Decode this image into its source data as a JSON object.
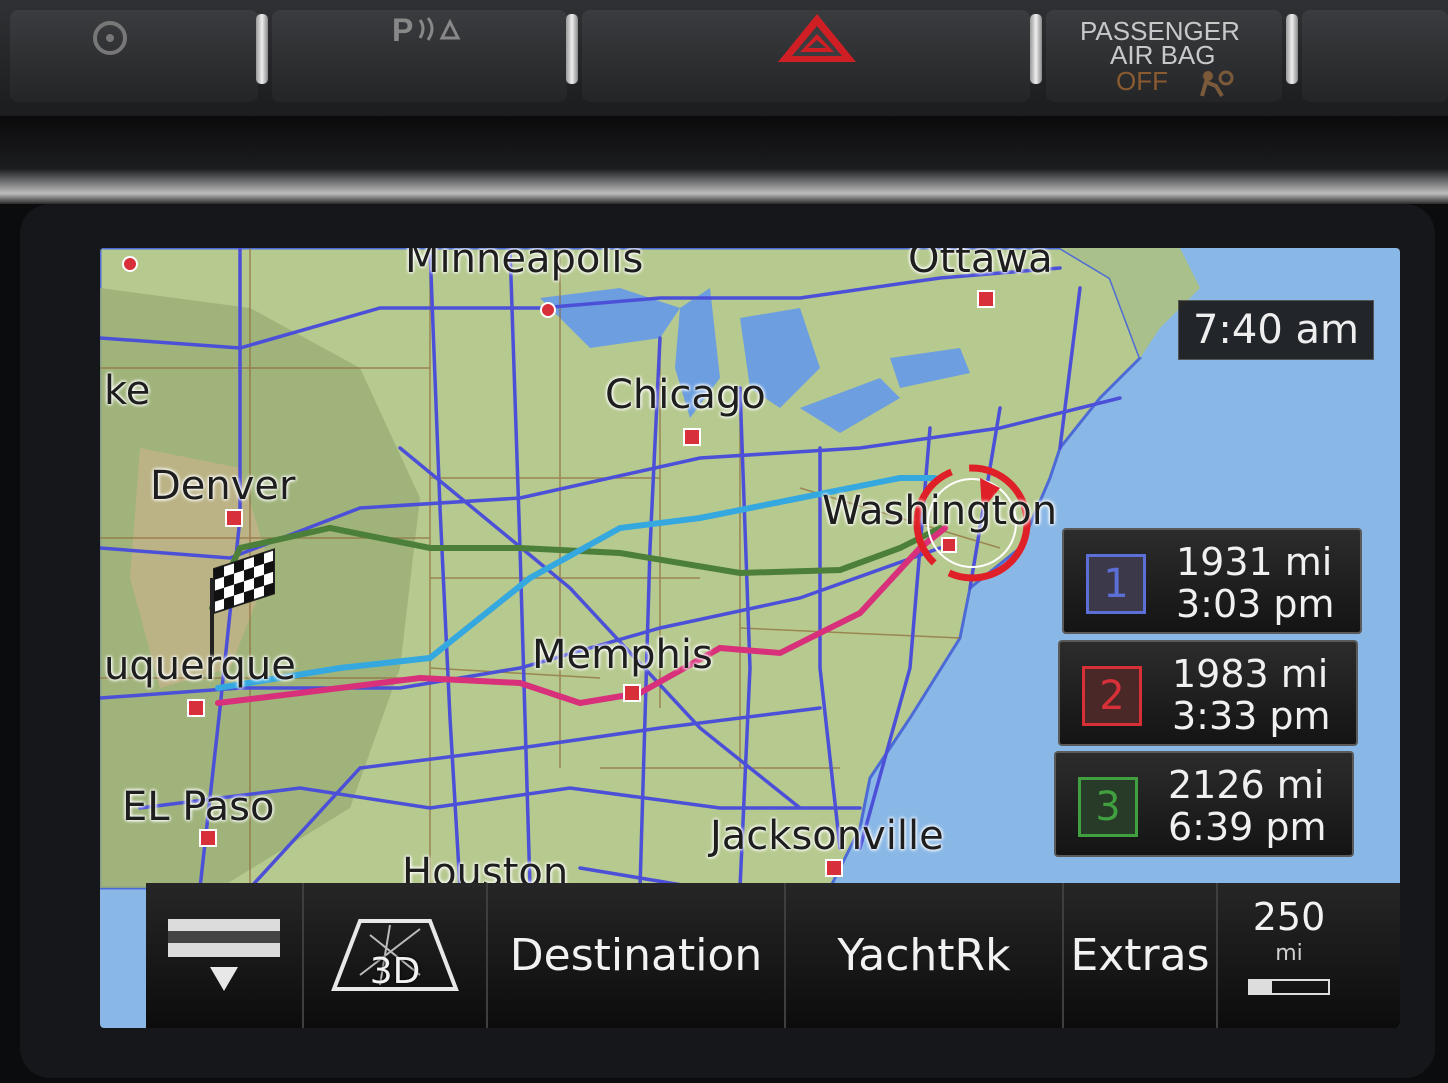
{
  "dashboard": {
    "airbag_line1": "PASSENGER",
    "airbag_line2": "AIR BAG",
    "airbag_line3": "OFF",
    "park_label": "P"
  },
  "map": {
    "clock": "7:40 am",
    "cities": {
      "minneapolis": "Minneapolis",
      "ottawa": "Ottawa",
      "chicago": "Chicago",
      "denver": "Denver",
      "washington": "Washington",
      "memphis": "Memphis",
      "albuquerque": "uquerque",
      "el_paso": "EL Paso",
      "houston": "Houston",
      "jacksonville": "Jacksonville",
      "ke": "ke"
    }
  },
  "routes": [
    {
      "number": "1",
      "distance": "1931 mi",
      "eta": "3:03 pm",
      "color": "#5b6fd6"
    },
    {
      "number": "2",
      "distance": "1983 mi",
      "eta": "3:33 pm",
      "color": "#d83038"
    },
    {
      "number": "3",
      "distance": "2126 mi",
      "eta": "6:39 pm",
      "color": "#40a040"
    }
  ],
  "toolbar": {
    "view_3d_label": "3D",
    "destination_label": "Destination",
    "yachtrk_label": "YachtRk",
    "extras_label": "Extras",
    "scale_value": "250",
    "scale_unit": "mi",
    "scale_level": 0.28
  }
}
